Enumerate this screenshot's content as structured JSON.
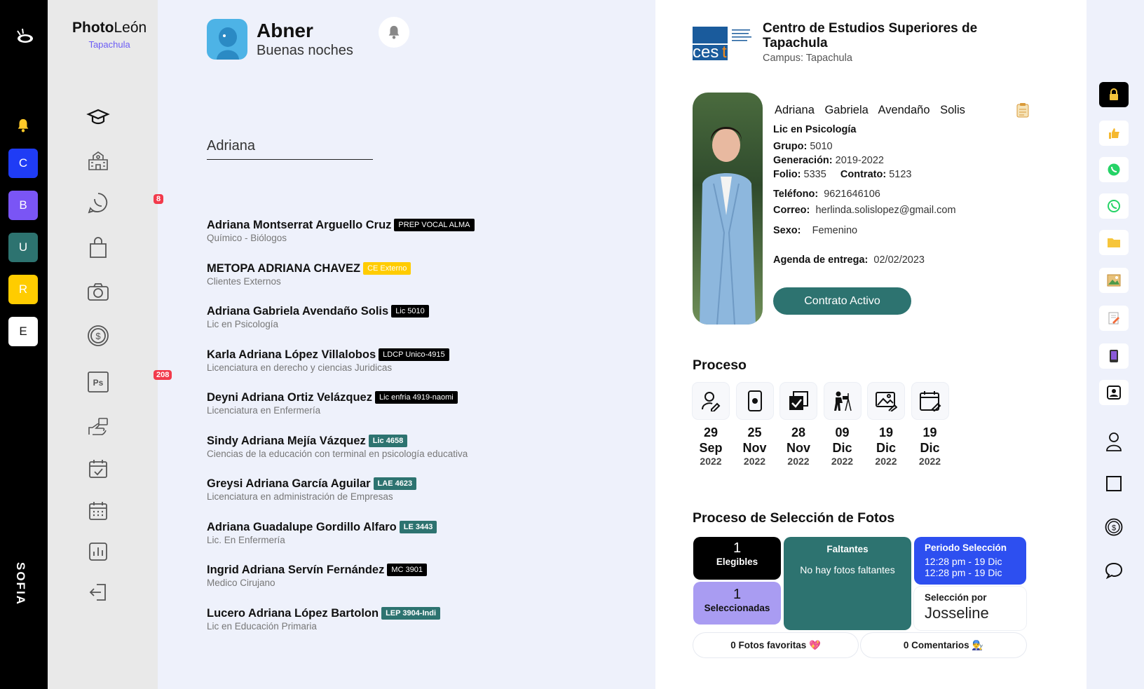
{
  "rail": {
    "workspaces": [
      {
        "letter": "C",
        "color": "#1f3cf5"
      },
      {
        "letter": "B",
        "color": "#7a55f5"
      },
      {
        "letter": "U",
        "color": "#2d7370"
      },
      {
        "letter": "R",
        "color": "#ffcc00"
      },
      {
        "letter": "E",
        "color": "#ffffff"
      }
    ],
    "sofia": "SOFIA"
  },
  "brand": {
    "photo": "Photo",
    "leon": "León",
    "city": "Tapachula"
  },
  "nav": {
    "whatsapp_badge": "8",
    "photoshop_badge": "208"
  },
  "user": {
    "name": "Abner",
    "greeting": "Buenas noches"
  },
  "search": {
    "value": "Adriana"
  },
  "results": [
    {
      "name": "Adriana Montserrat Arguello Cruz",
      "tag": "PREP VOCAL ALMA",
      "style": "dark",
      "program": "Químico - Biólogos"
    },
    {
      "name": "METOPA ADRIANA CHAVEZ",
      "tag": "CE Externo",
      "style": "yellow",
      "program": "Clientes Externos"
    },
    {
      "name": "Adriana Gabriela Avendaño Solis",
      "tag": "Lic 5010",
      "style": "dark",
      "program": "Lic en Psicología"
    },
    {
      "name": "Karla Adriana López Villalobos",
      "tag": "LDCP Unico-4915",
      "style": "dark",
      "program": "Licenciatura en derecho y ciencias Juridicas"
    },
    {
      "name": "Deyni Adriana Ortiz Velázquez",
      "tag": "Lic enfria 4919-naomi",
      "style": "dark",
      "program": "Licenciatura en Enfermería"
    },
    {
      "name": "Sindy Adriana Mejía Vázquez",
      "tag": "Lic 4658",
      "style": "teal",
      "program": "Ciencias de la educación con terminal en psicología educativa"
    },
    {
      "name": "Greysi Adriana García Aguilar",
      "tag": "LAE 4623",
      "style": "teal",
      "program": "Licenciatura en administración de Empresas"
    },
    {
      "name": "Adriana Guadalupe Gordillo Alfaro",
      "tag": "LE 3443",
      "style": "teal",
      "program": "Lic. En Enfermería"
    },
    {
      "name": "Ingrid Adriana Servín Fernández",
      "tag": "MC 3901",
      "style": "dark",
      "program": "Medico Cirujano"
    },
    {
      "name": "Lucero Adriana López Bartolon",
      "tag": "LEP 3904-Indi",
      "style": "teal",
      "program": "Lic en Educación Primaria"
    }
  ],
  "school": {
    "name": "Centro de Estudios Superiores de Tapachula",
    "campus": "Campus: Tapachula"
  },
  "student": {
    "name": "Adriana  Gabriela  Avendaño  Solis",
    "program": "Lic en Psicología",
    "grupo_label": "Grupo:",
    "grupo": "5010",
    "gen_label": "Generación:",
    "gen": "2019-2022",
    "folio_label": "Folio:",
    "folio": "5335",
    "contrato_label": "Contrato:",
    "contrato": "5123",
    "tel_label": "Teléfono:",
    "tel": "9621646106",
    "correo_label": "Correo:",
    "correo": "herlinda.solislopez@gmail.com",
    "sexo_label": "Sexo:",
    "sexo": "Femenino",
    "agenda_label": "Agenda de entrega:",
    "agenda": "02/02/2023",
    "status_button": "Contrato Activo"
  },
  "proceso": {
    "title": "Proceso",
    "steps": [
      {
        "icon": "user-edit-icon",
        "day": "29",
        "month": "Sep",
        "year": "2022"
      },
      {
        "icon": "phone-icon",
        "day": "25",
        "month": "Nov",
        "year": "2022"
      },
      {
        "icon": "checklist-icon",
        "day": "28",
        "month": "Nov",
        "year": "2022"
      },
      {
        "icon": "photographer-icon",
        "day": "09",
        "month": "Dic",
        "year": "2022"
      },
      {
        "icon": "photo-edit-icon",
        "day": "19",
        "month": "Dic",
        "year": "2022"
      },
      {
        "icon": "calendar-edit-icon",
        "day": "19",
        "month": "Dic",
        "year": "2022"
      }
    ]
  },
  "seleccion": {
    "title": "Proceso de Selección de Fotos",
    "elegibles_count": "1",
    "elegibles_label": "Elegibles",
    "seleccionadas_count": "1",
    "seleccionadas_label": "Seleccionadas",
    "faltantes_title": "Faltantes",
    "faltantes_text": "No hay fotos faltantes",
    "periodo_title": "Periodo Selección",
    "periodo_line1": "12:28 pm - 19 Dic",
    "periodo_line2": "12:28 pm - 19 Dic",
    "por_label": "Selección por",
    "por_name": "Josseline",
    "favoritas": "0 Fotos favoritas 💖",
    "comentarios": "0 Comentarios 👨‍🔧"
  },
  "colors": {
    "teal": "#2d7370",
    "purple": "#6b5cf5",
    "blue": "#2d4ff0",
    "lilac": "#a99cf2"
  }
}
